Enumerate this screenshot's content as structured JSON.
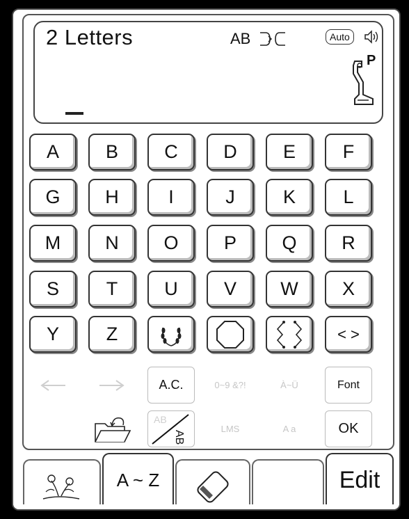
{
  "display": {
    "title": "2 Letters",
    "style_label": "AB",
    "auto_label": "Auto",
    "foot_label": "P"
  },
  "letter_keys": [
    "A",
    "B",
    "C",
    "D",
    "E",
    "F",
    "G",
    "H",
    "I",
    "J",
    "K",
    "L",
    "M",
    "N",
    "O",
    "P",
    "Q",
    "R",
    "S",
    "T",
    "U",
    "V",
    "W",
    "X",
    "Y",
    "Z"
  ],
  "frame_keys": [
    "laurel-frame-icon",
    "octagon-frame-icon",
    "bracket-frame-icon",
    "angle-bracket-frame-icon"
  ],
  "frame_key_text": {
    "angle_bracket": "< >"
  },
  "function_keys": {
    "ac_label": "A.C.",
    "numbers_label": "0~9 &?!",
    "accent_label": "À~Ü",
    "font_label": "Font",
    "lms_label": "LMS",
    "case_label": "A a",
    "ok_label": "OK"
  },
  "tabs": {
    "az_label": "A ~ Z",
    "edit_label": "Edit"
  },
  "colors": {
    "background": "#000000",
    "panel": "#ffffff",
    "border": "#333333",
    "disabled": "#c6c6c6"
  }
}
